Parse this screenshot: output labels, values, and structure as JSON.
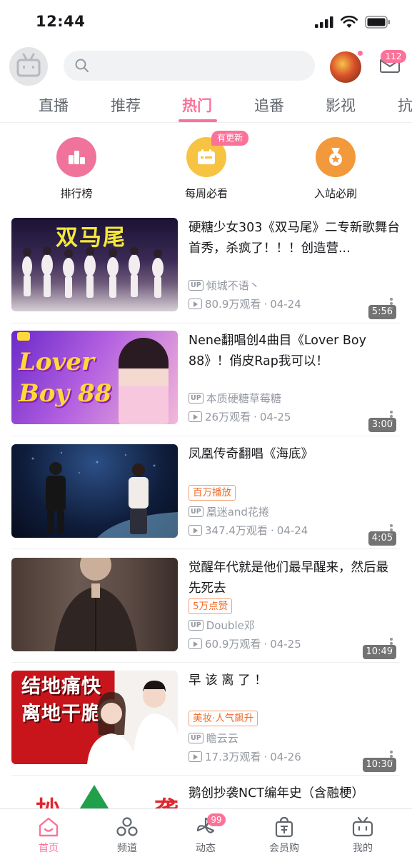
{
  "status_bar": {
    "time": "12:44"
  },
  "header": {
    "mail_badge": "112"
  },
  "tabs": [
    {
      "label": "直播",
      "active": false
    },
    {
      "label": "推荐",
      "active": false
    },
    {
      "label": "热门",
      "active": true
    },
    {
      "label": "追番",
      "active": false
    },
    {
      "label": "影视",
      "active": false
    },
    {
      "label": "抗",
      "active": false
    }
  ],
  "shortcuts": [
    {
      "label": "排行榜",
      "color": "#f0739b"
    },
    {
      "label": "每周必看",
      "color": "#f6c343",
      "badge": "有更新"
    },
    {
      "label": "入站必刷",
      "color": "#f2993c"
    }
  ],
  "videos": [
    {
      "title": "硬糖少女303《双马尾》二专新歌舞台首秀，杀疯了！！！创造营...",
      "thumb_text": "双马尾",
      "duration": "5:56",
      "tag": "",
      "up": "倾城不语丶",
      "views": "80.9万观看",
      "date": "04-24"
    },
    {
      "title": "Nene翻唱创4曲目《Lover Boy 88》！俏皮Rap我可以！",
      "thumb_text": "Lover Boy 88",
      "duration": "3:00",
      "tag": "",
      "up": "本质硬糖草莓糖",
      "views": "26万观看",
      "date": "04-25"
    },
    {
      "title": "凤凰传奇翻唱《海底》",
      "thumb_text": "",
      "duration": "4:05",
      "tag": "百万播放",
      "up": "凰迷and花捲",
      "views": "347.4万观看",
      "date": "04-24"
    },
    {
      "title": "觉醒年代就是他们最早醒来，然后最先死去",
      "thumb_text": "",
      "duration": "10:49",
      "tag": "5万点赞",
      "up": "Double邓",
      "views": "60.9万观看",
      "date": "04-25"
    },
    {
      "title": "早 该 离 了 ！",
      "thumb_text": "结地痛快 离地干脆",
      "duration": "10:30",
      "tag": "美妆·人气飙升",
      "up": "瞻云云",
      "views": "17.3万观看",
      "date": "04-26"
    },
    {
      "title": "鹅创抄袭NCT编年史（含融梗）",
      "thumb_text": "抄 袭",
      "duration": "",
      "tag": "",
      "up": "",
      "views": "",
      "date": ""
    }
  ],
  "bottom_nav": [
    {
      "label": "首页",
      "active": true,
      "icon": "home-icon"
    },
    {
      "label": "频道",
      "active": false,
      "icon": "channel-icon"
    },
    {
      "label": "动态",
      "active": false,
      "icon": "dynamic-icon",
      "badge": "99"
    },
    {
      "label": "会员购",
      "active": false,
      "icon": "shop-icon"
    },
    {
      "label": "我的",
      "active": false,
      "icon": "tv-icon"
    }
  ],
  "colors": {
    "accent": "#fb7299",
    "tag": "#f26c2a"
  }
}
